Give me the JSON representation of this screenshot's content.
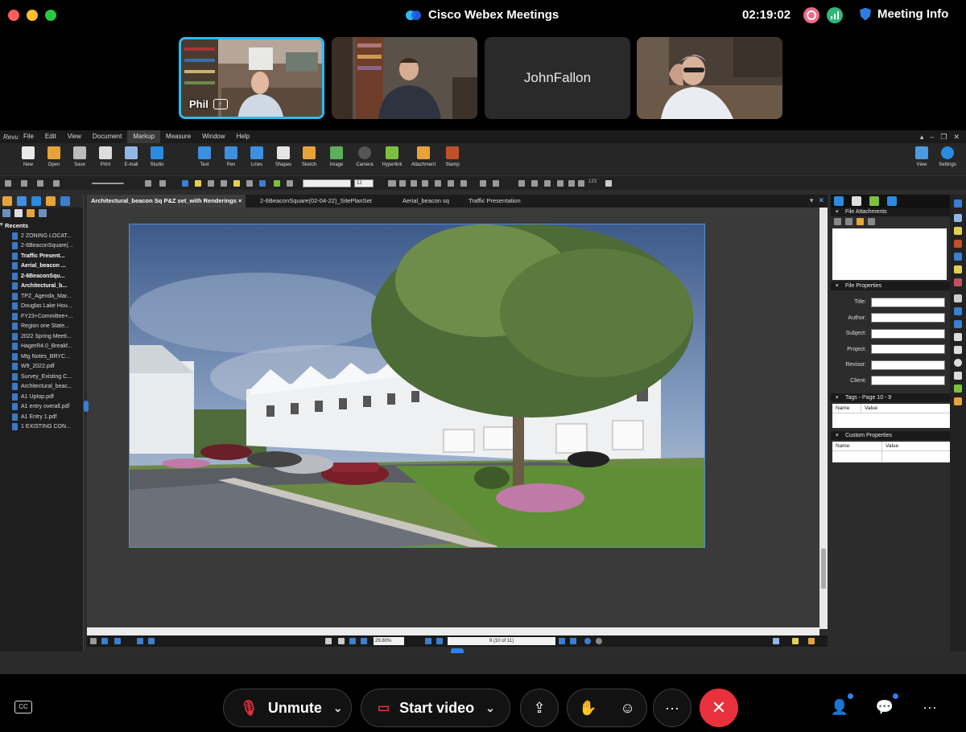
{
  "webex": {
    "app_title": "Cisco Webex Meetings",
    "timer": "02:19:02",
    "meeting_info_label": "Meeting Info",
    "participants": [
      {
        "name": "Phil",
        "sharing": true,
        "active": true
      },
      {
        "name": "",
        "sharing": false,
        "active": false
      },
      {
        "name": "JohnFallon",
        "sharing": false,
        "active": false
      },
      {
        "name": "",
        "sharing": false,
        "active": false
      }
    ],
    "controls": {
      "unmute_label": "Unmute",
      "start_video_label": "Start video",
      "more_label": "···",
      "cc_label": "CC",
      "end_icon": "✕"
    },
    "colors": {
      "accent": "#2dbbf2",
      "end_call": "#e8313c",
      "notify_dot": "#2f80ed"
    }
  },
  "revu": {
    "logo": "Revu",
    "menu": [
      "File",
      "Edit",
      "View",
      "Document",
      "Markup",
      "Measure",
      "Window",
      "Help"
    ],
    "active_menu": "Markup",
    "ribbon_left": [
      "New",
      "Open",
      "Save",
      "Print",
      "E-mail",
      "Studio"
    ],
    "ribbon_tools": [
      "Text",
      "Pen",
      "Lines",
      "Shapes",
      "Sketch",
      "Image",
      "Camera",
      "Hyperlink",
      "Attachment",
      "Stamp"
    ],
    "ribbon_right": [
      "View",
      "Settings"
    ],
    "font_size_value": "12",
    "toolbar_counter": "123",
    "recents_label": "Recents",
    "recents": [
      {
        "name": "2 ZONING LOCAT...",
        "bold": false
      },
      {
        "name": "2-6BeaconSquare(...",
        "bold": false
      },
      {
        "name": "Traffic Present...",
        "bold": true
      },
      {
        "name": "Aerial_beacon ...",
        "bold": true
      },
      {
        "name": "2-6BeaconSqu...",
        "bold": true
      },
      {
        "name": "Architectural_b...",
        "bold": true
      },
      {
        "name": "TPZ_Agenda_Mar...",
        "bold": false
      },
      {
        "name": "Douglas Lake Hou...",
        "bold": false
      },
      {
        "name": "FY23+Committee+...",
        "bold": false
      },
      {
        "name": "Region one State...",
        "bold": false
      },
      {
        "name": "2022 Spring Meeti...",
        "bold": false
      },
      {
        "name": "HagerR4.0_Breakf...",
        "bold": false
      },
      {
        "name": "Mtg Notes_BRYC...",
        "bold": false
      },
      {
        "name": "W9_2022.pdf",
        "bold": false
      },
      {
        "name": "Survey_Existing C...",
        "bold": false
      },
      {
        "name": "Architectural_beac...",
        "bold": false
      },
      {
        "name": "A1 Uptop.pdf",
        "bold": false
      },
      {
        "name": "A1 entry overall.pdf",
        "bold": false
      },
      {
        "name": "A1 Entry 1.pdf",
        "bold": false
      },
      {
        "name": "1 EXISTING CON...",
        "bold": false
      }
    ],
    "doc_tabs": [
      {
        "label": "Architectural_beacon Sq P&Z set_with Renderings",
        "active": true
      },
      {
        "label": "2-6BeaconSquare(02-04-22)_SitePlanSet",
        "active": false
      },
      {
        "label": "Aerial_beacon sq",
        "active": false
      },
      {
        "label": "Traffic Presentation",
        "active": false
      }
    ],
    "tab_close": "×",
    "status": {
      "zoom": "29.80%",
      "page": "9 (10 of 11)"
    },
    "right_panel": {
      "file_attachments": "File Attachments",
      "file_properties": "File Properties",
      "props": [
        "Title:",
        "Author:",
        "Subject:",
        "Project:",
        "Revisor:",
        "Client:"
      ],
      "tags_head": "Tags - Page 10 - 9",
      "custom_props_head": "Custom Properties",
      "col_name": "Name",
      "col_value": "Value"
    }
  }
}
